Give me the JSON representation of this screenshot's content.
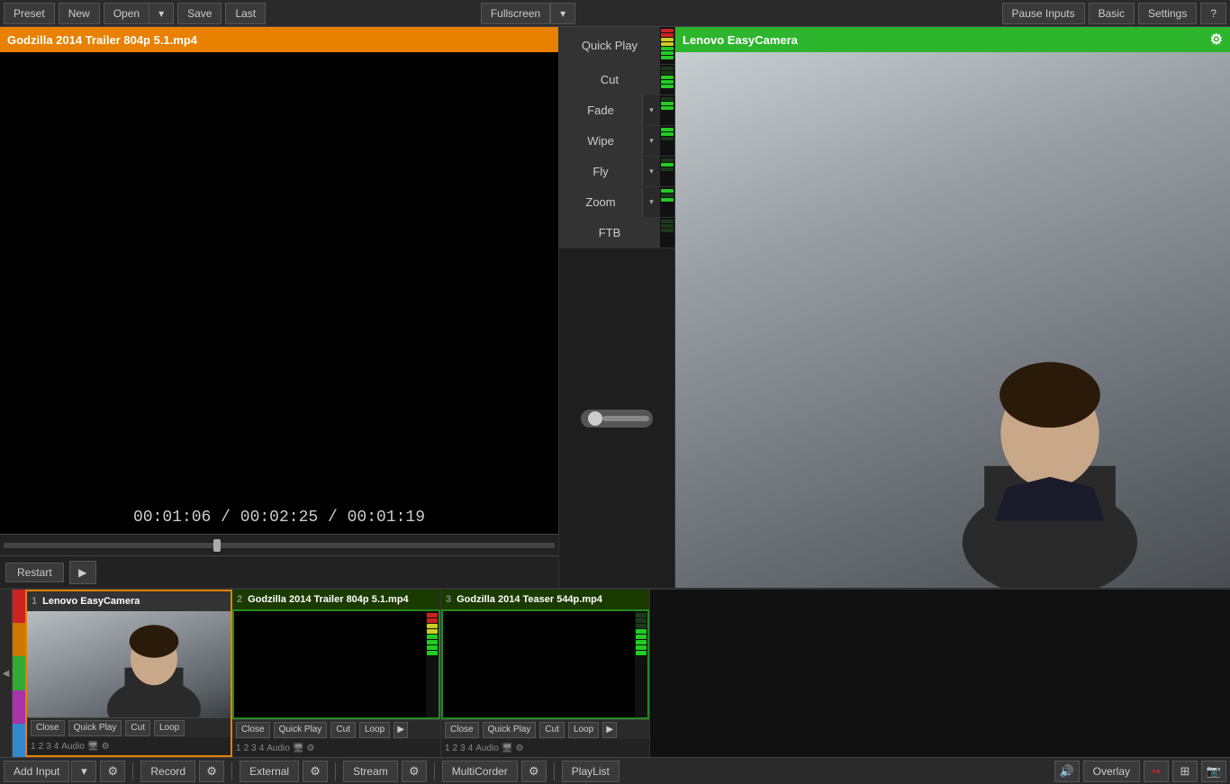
{
  "topbar": {
    "preset": "Preset",
    "new": "New",
    "open": "Open",
    "save": "Save",
    "last": "Last",
    "fullscreen": "Fullscreen",
    "pause_inputs": "Pause Inputs",
    "basic": "Basic",
    "settings": "Settings",
    "help": "?"
  },
  "preview": {
    "title": "Godzilla 2014 Trailer 804p 5.1.mp4",
    "time_current": "00:01:06",
    "time_total": "00:02:25",
    "time_remaining": "00:01:19",
    "restart": "Restart"
  },
  "transitions": {
    "quick_play": "Quick Play",
    "cut": "Cut",
    "fade": "Fade",
    "wipe": "Wipe",
    "fly": "Fly",
    "zoom": "Zoom",
    "ftb": "FTB"
  },
  "camera": {
    "title": "Lenovo EasyCamera"
  },
  "input_tiles": [
    {
      "num": "1",
      "title": "Lenovo EasyCamera",
      "close": "Close",
      "quick_play": "Quick Play",
      "cut": "Cut",
      "loop": "Loop",
      "audio": "Audio",
      "tabs": [
        "1",
        "2",
        "3",
        "4"
      ]
    },
    {
      "num": "2",
      "title": "Godzilla 2014 Trailer 804p 5.1.mp4",
      "close": "Close",
      "quick_play": "Quick Play",
      "cut": "Cut",
      "loop": "Loop",
      "audio": "Audio",
      "tabs": [
        "1",
        "2",
        "3",
        "4"
      ]
    },
    {
      "num": "3",
      "title": "Godzilla 2014 Teaser 544p.mp4",
      "close": "Close",
      "quick_play": "Quick Play",
      "cut": "Cut",
      "loop": "Loop",
      "audio": "Audio",
      "tabs": [
        "1",
        "2",
        "3",
        "4"
      ]
    }
  ],
  "bottom_bar": {
    "add_input": "Add Input",
    "record": "Record",
    "external": "External",
    "stream": "Stream",
    "multicorder": "MultiCorder",
    "playlist": "PlayList",
    "overlay": "Overlay"
  },
  "colors": {
    "accent_orange": "#e88000",
    "accent_green": "#2db52d",
    "dark_bg": "#1a1a1a",
    "tile_border_green": "#2a5a00"
  }
}
